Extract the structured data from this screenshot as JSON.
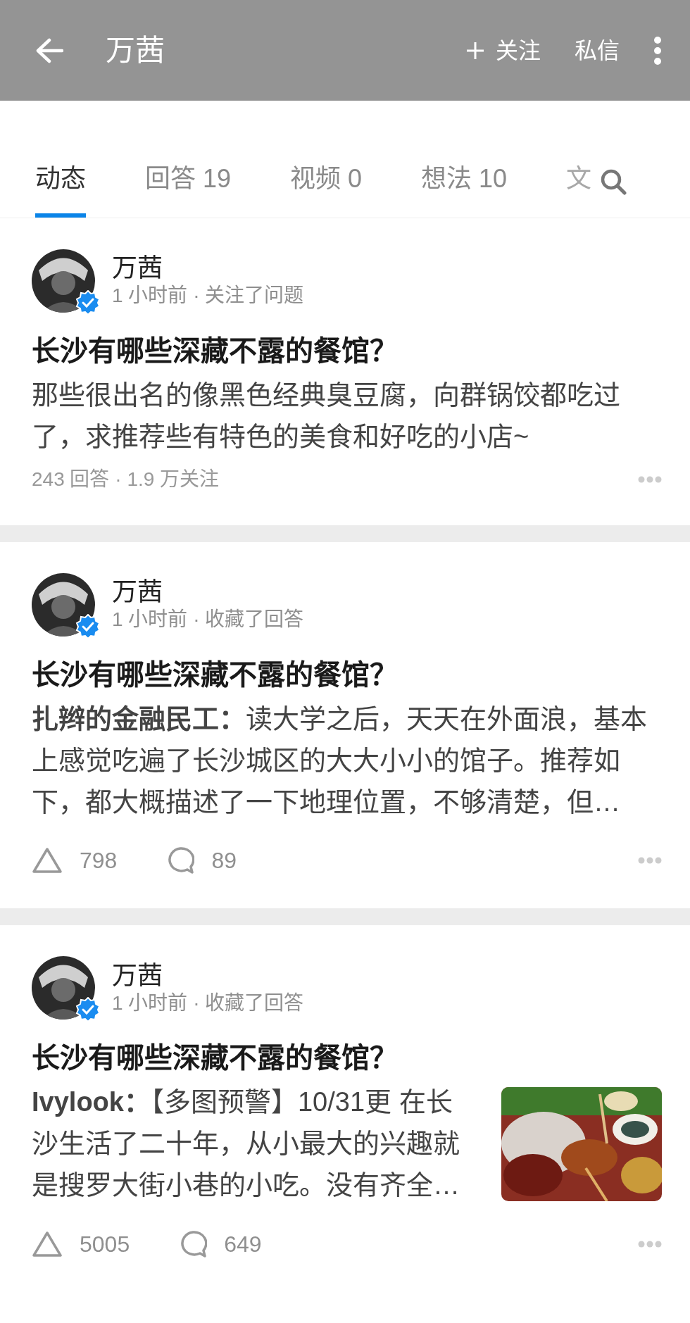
{
  "header": {
    "title": "万茜",
    "follow": "关注",
    "message": "私信"
  },
  "tabs": [
    {
      "label": "动态",
      "selected": true
    },
    {
      "label": "回答 19",
      "selected": false
    },
    {
      "label": "视频 0",
      "selected": false
    },
    {
      "label": "想法 10",
      "selected": false
    },
    {
      "label": "文",
      "selected": false
    }
  ],
  "feed": [
    {
      "kind": "question",
      "author": "万茜",
      "verified": true,
      "meta": "1 小时前 · 关注了问题",
      "title": "长沙有哪些深藏不露的餐馆？",
      "excerpt": "那些很出名的像黑色经典臭豆腐，向群锅饺都吃过了，求推荐些有特色的美食和好吃的小店~",
      "stats": "243 回答 · 1.9 万关注"
    },
    {
      "kind": "answer",
      "author": "万茜",
      "verified": true,
      "meta": "1 小时前 · 收藏了回答",
      "title": "长沙有哪些深藏不露的餐馆？",
      "excerpt": "**扎辫的金融民工：**读大学之后，天天在外面浪，基本上感觉吃遍了长沙城区的大大小小的馆子。推荐如下，都大概描述了一下地理位置，不够清楚，但…",
      "likes": "798",
      "comments": "89"
    },
    {
      "kind": "answer",
      "author": "万茜",
      "verified": true,
      "meta": "1 小时前 · 收藏了回答",
      "title": "长沙有哪些深藏不露的餐馆？",
      "excerpt": "**Ivylook：**【多图预警】10/31更 在长沙生活了二十年，从小最大的兴趣就是搜罗大街小巷的小吃。没有齐全…",
      "likes": "5005",
      "comments": "649"
    }
  ]
}
